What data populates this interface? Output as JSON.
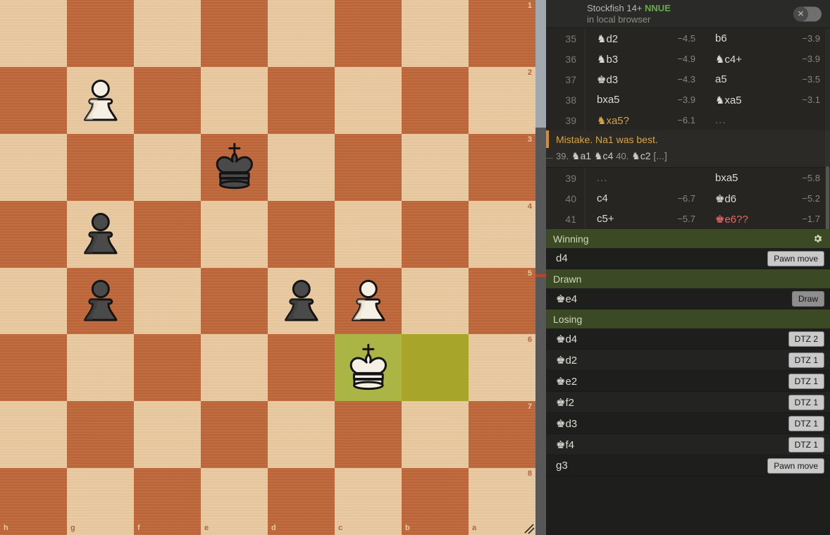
{
  "board": {
    "orientation": "black",
    "files": [
      "h",
      "g",
      "f",
      "e",
      "d",
      "c",
      "b",
      "a"
    ],
    "ranks": [
      "1",
      "2",
      "3",
      "4",
      "5",
      "6",
      "7",
      "8"
    ],
    "pieces": [
      {
        "square": "g2",
        "color": "white",
        "type": "pawn"
      },
      {
        "square": "e3",
        "color": "black",
        "type": "king"
      },
      {
        "square": "g4",
        "color": "black",
        "type": "pawn"
      },
      {
        "square": "g5",
        "color": "black",
        "type": "pawn"
      },
      {
        "square": "d5",
        "color": "black",
        "type": "pawn"
      },
      {
        "square": "c5",
        "color": "white",
        "type": "pawn"
      },
      {
        "square": "c6",
        "color": "white",
        "type": "king"
      }
    ],
    "highlight_move_to": "c6",
    "highlight_move_from": "b6",
    "highlight_color_to": "#aab546",
    "highlight_color_from": "#a7a52a",
    "light_square_color": "#e8c9a0",
    "dark_square_color": "#c0693c"
  },
  "eval_bar": {
    "white_fraction": 0.238,
    "marker_fraction": 0.513,
    "white_color": "#a2a9ae",
    "black_color": "#575757",
    "marker_color": "#b4452e"
  },
  "engine": {
    "name": "Stockfish 14+",
    "nnue_label": "NNUE",
    "location": "in local browser",
    "nnue_color": "#6aa84f",
    "toggle_state": "off",
    "toggle_icon": "close-icon"
  },
  "moves_before": [
    {
      "number": "35",
      "white": {
        "san": "♞d2",
        "eval": "−4.5",
        "quality": "normal"
      },
      "black": {
        "san": "b6",
        "eval": "−3.9",
        "quality": "normal"
      }
    },
    {
      "number": "36",
      "white": {
        "san": "♞b3",
        "eval": "−4.9",
        "quality": "normal"
      },
      "black": {
        "san": "♞c4+",
        "eval": "−3.9",
        "quality": "normal"
      }
    },
    {
      "number": "37",
      "white": {
        "san": "♚d3",
        "eval": "−4.3",
        "quality": "normal"
      },
      "black": {
        "san": "a5",
        "eval": "−3.5",
        "quality": "normal"
      }
    },
    {
      "number": "38",
      "white": {
        "san": "bxa5",
        "eval": "−3.9",
        "quality": "normal"
      },
      "black": {
        "san": "♞xa5",
        "eval": "−3.1",
        "quality": "normal"
      }
    },
    {
      "number": "39",
      "white": {
        "san": "♞xa5?",
        "eval": "−6.1",
        "quality": "inaccuracy"
      },
      "black": {
        "san": "...",
        "eval": "",
        "quality": "ellipsis"
      }
    }
  ],
  "annotation": {
    "text": "Mistake. Na1 was best.",
    "variation_number": "39.",
    "variation_moves": "♞a1  ♞c4",
    "variation_number2": "40.",
    "variation_moves2": "♞c2",
    "variation_more": "[...]",
    "accent_color": "#d98f20"
  },
  "moves_after": [
    {
      "number": "39",
      "white": {
        "san": "...",
        "eval": "",
        "quality": "ellipsis"
      },
      "black": {
        "san": "bxa5",
        "eval": "−5.8",
        "quality": "normal"
      }
    },
    {
      "number": "40",
      "white": {
        "san": "c4",
        "eval": "−6.7",
        "quality": "normal"
      },
      "black": {
        "san": "♚d6",
        "eval": "−5.2",
        "quality": "normal"
      }
    },
    {
      "number": "41",
      "white": {
        "san": "c5+",
        "eval": "−5.7",
        "quality": "normal"
      },
      "black": {
        "san": "♚e6??",
        "eval": "−1.7",
        "quality": "blunder"
      }
    }
  ],
  "tablebase": {
    "header_color": "#3b4a24",
    "gear_icon": "gear-icon",
    "groups": [
      {
        "title": "Winning",
        "has_gear": true,
        "moves": [
          {
            "san": "d4",
            "badge": "Pawn move",
            "badge_type": "pawn"
          }
        ]
      },
      {
        "title": "Drawn",
        "has_gear": false,
        "moves": [
          {
            "san": "♚e4",
            "badge": "Draw",
            "badge_type": "draw"
          }
        ]
      },
      {
        "title": "Losing",
        "has_gear": false,
        "moves": [
          {
            "san": "♚d4",
            "badge": "DTZ 2",
            "badge_type": "loss"
          },
          {
            "san": "♚d2",
            "badge": "DTZ 1",
            "badge_type": "loss"
          },
          {
            "san": "♚e2",
            "badge": "DTZ 1",
            "badge_type": "loss"
          },
          {
            "san": "♚f2",
            "badge": "DTZ 1",
            "badge_type": "loss"
          },
          {
            "san": "♚d3",
            "badge": "DTZ 1",
            "badge_type": "loss"
          },
          {
            "san": "♚f4",
            "badge": "DTZ 1",
            "badge_type": "loss"
          },
          {
            "san": "g3",
            "badge": "Pawn move",
            "badge_type": "pawn"
          }
        ]
      }
    ]
  }
}
